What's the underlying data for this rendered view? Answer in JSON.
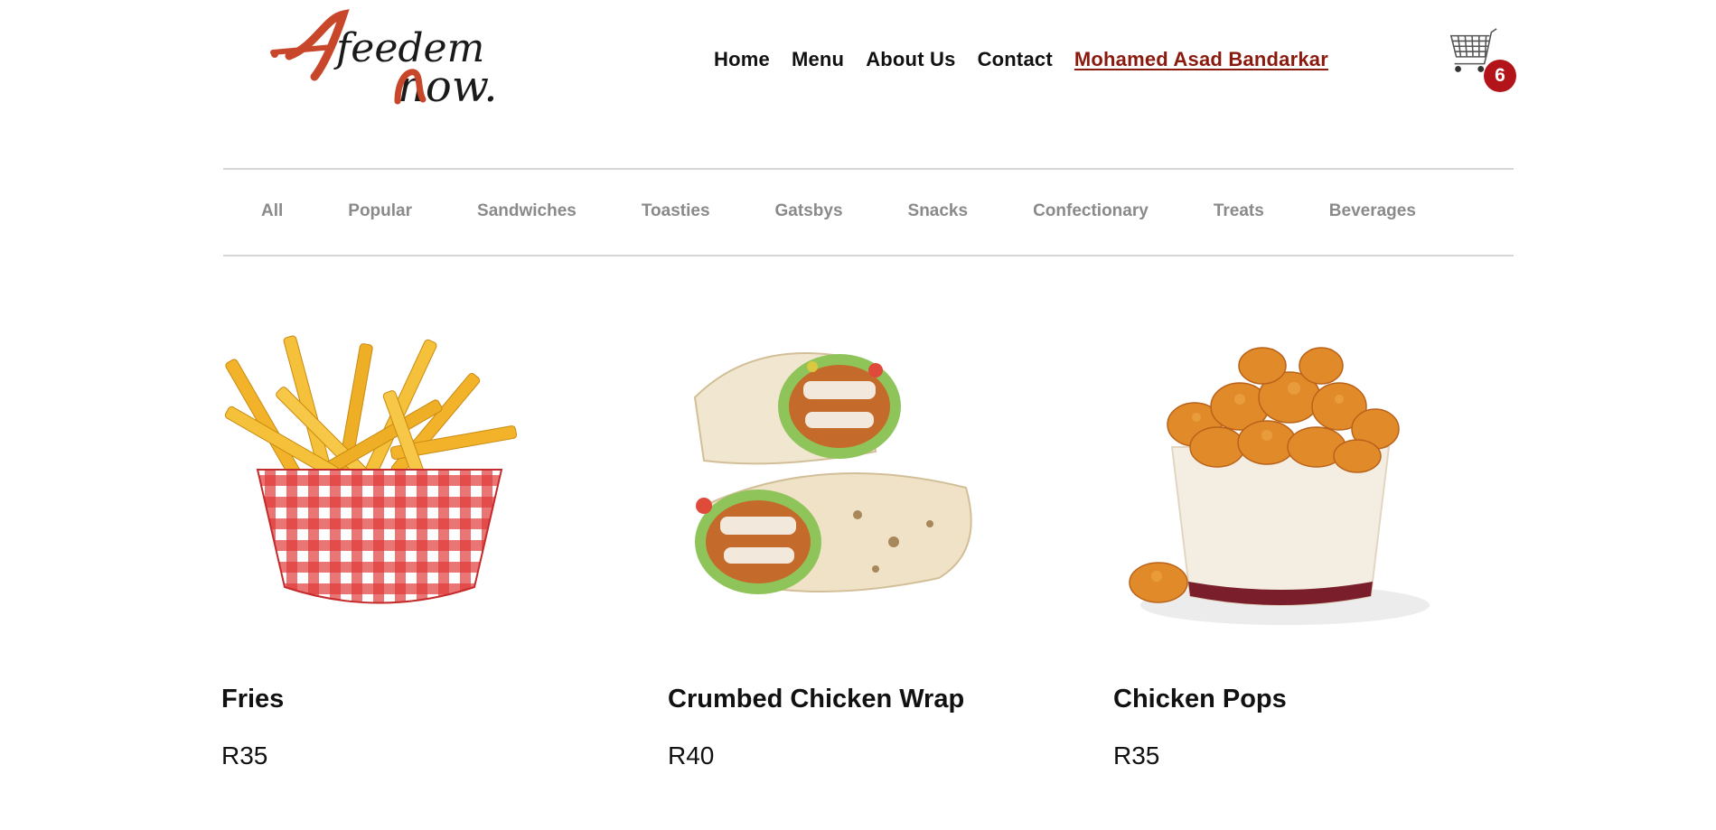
{
  "brand": {
    "logo_line1": "feedem",
    "logo_line2": "now.",
    "accent": "#c8472b",
    "dark": "#1a1a1a"
  },
  "nav": {
    "items": [
      {
        "label": "Home"
      },
      {
        "label": "Menu"
      },
      {
        "label": "About Us"
      },
      {
        "label": "Contact"
      }
    ],
    "user": "Mohamed Asad Bandarkar",
    "user_color": "#8b1a0e"
  },
  "cart": {
    "icon": "shopping-cart-icon",
    "count": "6",
    "badge_color": "#b3141a"
  },
  "categories": [
    {
      "label": "All"
    },
    {
      "label": "Popular"
    },
    {
      "label": "Sandwiches"
    },
    {
      "label": "Toasties"
    },
    {
      "label": "Gatsbys"
    },
    {
      "label": "Snacks"
    },
    {
      "label": "Confectionary"
    },
    {
      "label": "Treats"
    },
    {
      "label": "Beverages"
    }
  ],
  "products": [
    {
      "name": "Fries",
      "price": "R35",
      "image": "fries-in-checkered-basket"
    },
    {
      "name": "Crumbed Chicken Wrap",
      "price": "R40",
      "image": "chicken-wrap-halves"
    },
    {
      "name": "Chicken Pops",
      "price": "R35",
      "image": "chicken-pops-bucket"
    }
  ]
}
